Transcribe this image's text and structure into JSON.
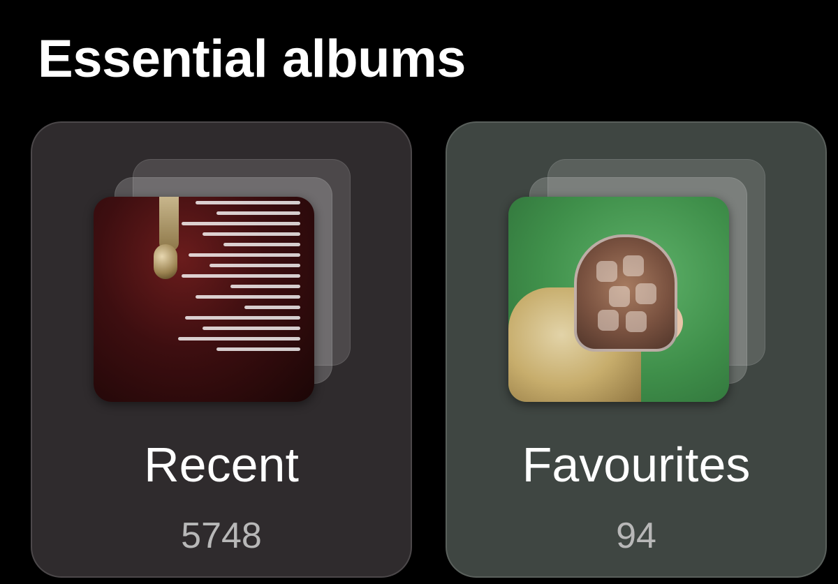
{
  "section": {
    "title": "Essential albums"
  },
  "albums": [
    {
      "name": "Recent",
      "count": "5748",
      "thumbnail_icon": "photo-stack-icon"
    },
    {
      "name": "Favourites",
      "count": "94",
      "thumbnail_icon": "photo-stack-icon"
    }
  ],
  "colors": {
    "background": "#000000",
    "recent_card": "#2f2b2d",
    "favourites_card": "#3f4642",
    "title_text": "#ffffff",
    "count_text": "#b8b8b8"
  }
}
